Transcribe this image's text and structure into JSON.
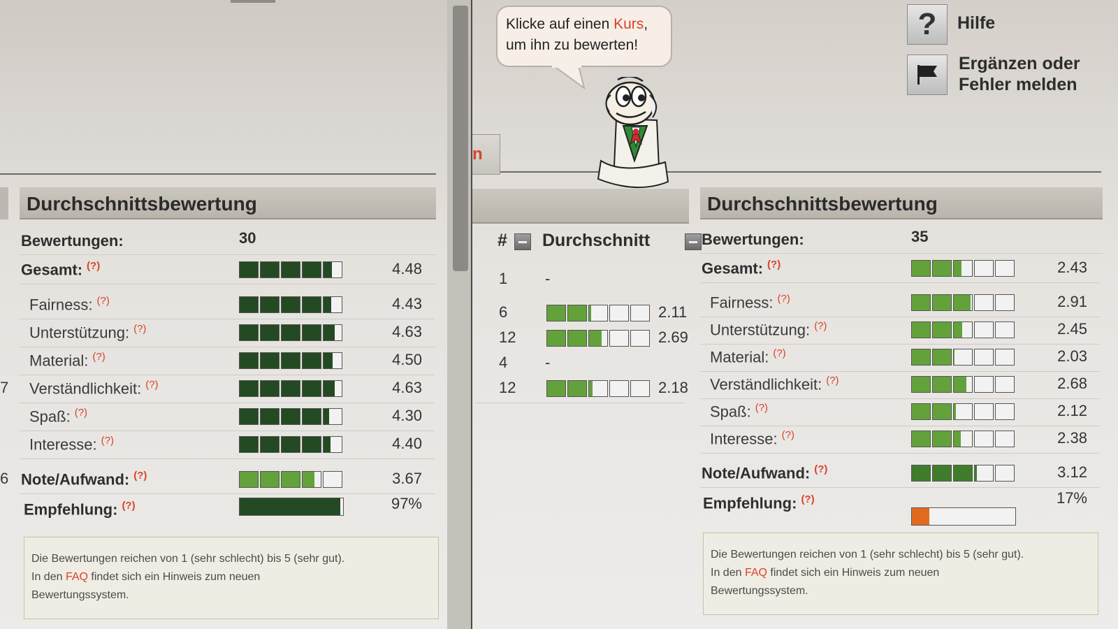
{
  "bubble": {
    "text_before": "Klicke auf einen ",
    "highlight": "Kurs",
    "text_after": ",",
    "line2": "um ihn zu bewerten!"
  },
  "help": {
    "label": "Hilfe",
    "icon": "question-icon"
  },
  "report": {
    "label_line1": "Ergänzen oder",
    "label_line2": "Fehler melden",
    "icon": "flag-icon"
  },
  "tab_fragment": "n",
  "colors": {
    "dark_green": "#234a22",
    "light_green": "#63a23a",
    "orange": "#e26a1e",
    "accent_red": "#d9422b"
  },
  "left": {
    "title": "Durchschnittsbewertung",
    "count_label": "Bewertungen:",
    "count": "30",
    "rows": [
      {
        "label": "Gesamt:",
        "value": "4.48",
        "score": 4.48,
        "bold": true,
        "style": "dark"
      },
      {
        "label": "Fairness:",
        "value": "4.43",
        "score": 4.43,
        "style": "dark"
      },
      {
        "label": "Unterstützung:",
        "value": "4.63",
        "score": 4.63,
        "style": "dark"
      },
      {
        "label": "Material:",
        "value": "4.50",
        "score": 4.5,
        "style": "dark"
      },
      {
        "label": "Verständlichkeit:",
        "value": "4.63",
        "score": 4.63,
        "style": "dark"
      },
      {
        "label": "Spaß:",
        "value": "4.30",
        "score": 4.3,
        "style": "dark"
      },
      {
        "label": "Interesse:",
        "value": "4.40",
        "score": 4.4,
        "style": "dark"
      },
      {
        "label": "Note/Aufwand:",
        "value": "3.67",
        "score": 3.67,
        "bold": true,
        "style": "light"
      }
    ],
    "recommend": {
      "label": "Empfehlung:",
      "value": "97%",
      "percent": 97
    },
    "edge_digits": [
      "7",
      "6"
    ],
    "note": {
      "line1": "Die Bewertungen reichen von 1 (sehr schlecht) bis 5 (sehr gut).",
      "in_den": "In den",
      "faq": "FAQ",
      "line2_rest": "findet sich ein Hinweis zum neuen",
      "line3": "Bewertungssystem."
    }
  },
  "middle": {
    "col_hash": "#",
    "col_avg": "Durchschnitt",
    "rows": [
      {
        "count": "1",
        "value": "-",
        "score": null
      },
      {
        "count": "6",
        "value": "2.11",
        "score": 2.11
      },
      {
        "count": "12",
        "value": "2.69",
        "score": 2.69
      },
      {
        "count": "4",
        "value": "-",
        "score": null
      },
      {
        "count": "12",
        "value": "2.18",
        "score": 2.18
      }
    ]
  },
  "right": {
    "title": "Durchschnittsbewertung",
    "count_label": "Bewertungen:",
    "count": "35",
    "rows": [
      {
        "label": "Gesamt:",
        "value": "2.43",
        "score": 2.43,
        "bold": true,
        "style": "light"
      },
      {
        "label": "Fairness:",
        "value": "2.91",
        "score": 2.91,
        "style": "light"
      },
      {
        "label": "Unterstützung:",
        "value": "2.45",
        "score": 2.45,
        "style": "light"
      },
      {
        "label": "Material:",
        "value": "2.03",
        "score": 2.03,
        "style": "light"
      },
      {
        "label": "Verständlichkeit:",
        "value": "2.68",
        "score": 2.68,
        "style": "light"
      },
      {
        "label": "Spaß:",
        "value": "2.12",
        "score": 2.12,
        "style": "light"
      },
      {
        "label": "Interesse:",
        "value": "2.38",
        "score": 2.38,
        "style": "light"
      },
      {
        "label": "Note/Aufwand:",
        "value": "3.12",
        "score": 3.12,
        "bold": true,
        "style": "mid"
      }
    ],
    "recommend": {
      "label": "Empfehlung:",
      "value": "17%",
      "percent": 17
    },
    "note": {
      "line1": "Die Bewertungen reichen von 1 (sehr schlecht) bis 5 (sehr gut).",
      "in_den": "In den",
      "faq": "FAQ",
      "line2_rest": "findet sich ein Hinweis zum neuen",
      "line3": "Bewertungssystem."
    }
  }
}
